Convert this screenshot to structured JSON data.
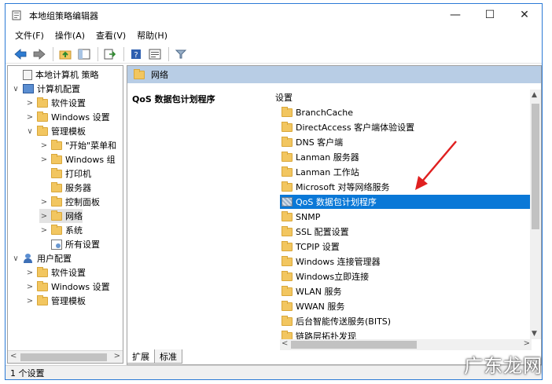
{
  "window": {
    "title": "本地组策略编辑器",
    "controls": {
      "minimize": "—",
      "maximize": "☐",
      "close": "✕"
    }
  },
  "menu": [
    "文件(F)",
    "操作(A)",
    "查看(V)",
    "帮助(H)"
  ],
  "toolbar": [
    "back-icon",
    "forward-icon",
    "up-folder-icon",
    "show-hide-tree-icon",
    "export-icon",
    "help-icon",
    "properties-icon",
    "filter-icon"
  ],
  "tree": [
    {
      "label": "本地计算机 策略",
      "level": 0,
      "icon": "doc",
      "expander": ""
    },
    {
      "label": "计算机配置",
      "level": 0,
      "icon": "pc",
      "expander": "∨"
    },
    {
      "label": "软件设置",
      "level": 1,
      "icon": "folder",
      "expander": ">"
    },
    {
      "label": "Windows 设置",
      "level": 1,
      "icon": "folder",
      "expander": ">"
    },
    {
      "label": "管理模板",
      "level": 1,
      "icon": "folder",
      "expander": "∨"
    },
    {
      "label": "\"开始\"菜单和",
      "level": 2,
      "icon": "folder",
      "expander": ">"
    },
    {
      "label": "Windows 组",
      "level": 2,
      "icon": "folder",
      "expander": ">"
    },
    {
      "label": "打印机",
      "level": 2,
      "icon": "folder",
      "expander": ""
    },
    {
      "label": "服务器",
      "level": 2,
      "icon": "folder",
      "expander": ""
    },
    {
      "label": "控制面板",
      "level": 2,
      "icon": "folder",
      "expander": ">"
    },
    {
      "label": "网络",
      "level": 2,
      "icon": "folder",
      "expander": ">",
      "selected": true
    },
    {
      "label": "系统",
      "level": 2,
      "icon": "folder",
      "expander": ">"
    },
    {
      "label": "所有设置",
      "level": 2,
      "icon": "setting",
      "expander": ""
    },
    {
      "label": "用户配置",
      "level": 0,
      "icon": "user",
      "expander": "∨"
    },
    {
      "label": "软件设置",
      "level": 1,
      "icon": "folder",
      "expander": ">"
    },
    {
      "label": "Windows 设置",
      "level": 1,
      "icon": "folder",
      "expander": ">"
    },
    {
      "label": "管理模板",
      "level": 1,
      "icon": "folder",
      "expander": ">"
    }
  ],
  "right": {
    "header": "网络",
    "extended_title": "QoS 数据包计划程序",
    "column_header": "设置",
    "items": [
      {
        "label": "BranchCache",
        "icon": "folder"
      },
      {
        "label": "DirectAccess 客户端体验设置",
        "icon": "folder"
      },
      {
        "label": "DNS 客户端",
        "icon": "folder"
      },
      {
        "label": "Lanman 服务器",
        "icon": "folder"
      },
      {
        "label": "Lanman 工作站",
        "icon": "folder"
      },
      {
        "label": "Microsoft 对等网络服务",
        "icon": "folder"
      },
      {
        "label": "QoS 数据包计划程序",
        "icon": "qos",
        "selected": true
      },
      {
        "label": "SNMP",
        "icon": "folder"
      },
      {
        "label": "SSL 配置设置",
        "icon": "folder"
      },
      {
        "label": "TCPIP 设置",
        "icon": "folder"
      },
      {
        "label": "Windows 连接管理器",
        "icon": "folder"
      },
      {
        "label": "Windows立即连接",
        "icon": "folder"
      },
      {
        "label": "WLAN 服务",
        "icon": "folder"
      },
      {
        "label": "WWAN 服务",
        "icon": "folder"
      },
      {
        "label": "后台智能传送服务(BITS)",
        "icon": "folder"
      },
      {
        "label": "链路层拓扑发现",
        "icon": "folder"
      }
    ]
  },
  "tabs": [
    "扩展",
    "标准"
  ],
  "status": "1 个设置",
  "watermark": "广东龙网",
  "colors": {
    "selection": "#0a78d7",
    "header": "#b8cde5",
    "arrow": "#e02020"
  }
}
